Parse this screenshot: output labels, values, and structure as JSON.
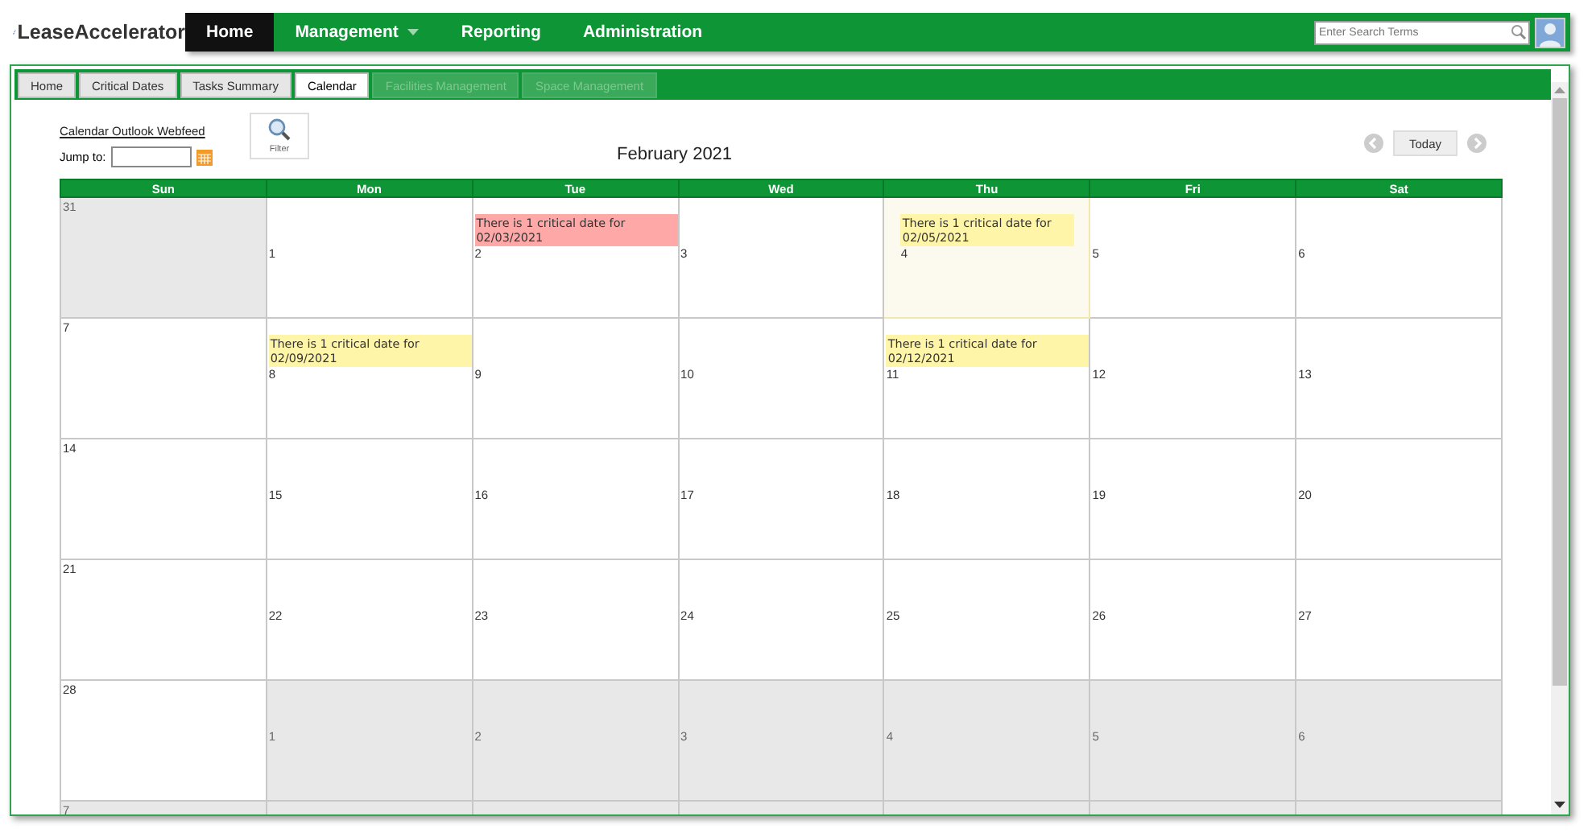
{
  "logo": {
    "text": "LeaseAccelerator"
  },
  "nav": [
    {
      "label": "Home",
      "selected": true,
      "dropdown": false
    },
    {
      "label": "Management",
      "selected": false,
      "dropdown": true
    },
    {
      "label": "Reporting",
      "selected": false,
      "dropdown": false
    },
    {
      "label": "Administration",
      "selected": false,
      "dropdown": false
    }
  ],
  "search": {
    "placeholder": "Enter Search Terms"
  },
  "tabs": [
    {
      "label": "Home",
      "selected": false,
      "disabled": false
    },
    {
      "label": "Critical Dates",
      "selected": false,
      "disabled": false
    },
    {
      "label": "Tasks Summary",
      "selected": false,
      "disabled": false
    },
    {
      "label": "Calendar",
      "selected": true,
      "disabled": false
    },
    {
      "label": "Facilities Management",
      "selected": false,
      "disabled": true
    },
    {
      "label": "Space Management",
      "selected": false,
      "disabled": true
    }
  ],
  "webfeed_link": "Calendar Outlook Webfeed",
  "jump_to": {
    "label": "Jump to:"
  },
  "filter_button": "Filter",
  "month_title": "February 2021",
  "today_button": "Today",
  "weekdays": [
    "Sun",
    "Mon",
    "Tue",
    "Wed",
    "Thu",
    "Fri",
    "Sat"
  ],
  "weeks": [
    [
      {
        "day": "31",
        "outside_month": true,
        "today": false
      },
      {
        "day": "1",
        "outside_month": false,
        "today": false
      },
      {
        "day": "2",
        "outside_month": false,
        "today": false,
        "events": [
          {
            "text": "There is 1 critical date for 02/03/2021",
            "color": "#ffa8a8"
          }
        ]
      },
      {
        "day": "3",
        "outside_month": false,
        "today": false
      },
      {
        "day": "4",
        "outside_month": false,
        "today": true,
        "events": [
          {
            "text": "There is 1 critical date for 02/05/2021",
            "color": "#fff5a8"
          }
        ]
      },
      {
        "day": "5",
        "outside_month": false,
        "today": false
      },
      {
        "day": "6",
        "outside_month": false,
        "today": false
      }
    ],
    [
      {
        "day": "7",
        "outside_month": false,
        "today": false
      },
      {
        "day": "8",
        "outside_month": false,
        "today": false,
        "events": [
          {
            "text": "There is 1 critical date for 02/09/2021",
            "color": "#fff5a8"
          }
        ]
      },
      {
        "day": "9",
        "outside_month": false,
        "today": false
      },
      {
        "day": "10",
        "outside_month": false,
        "today": false
      },
      {
        "day": "11",
        "outside_month": false,
        "today": false,
        "events": [
          {
            "text": "There is 1 critical date for 02/12/2021",
            "color": "#fff5a8"
          }
        ]
      },
      {
        "day": "12",
        "outside_month": false,
        "today": false
      },
      {
        "day": "13",
        "outside_month": false,
        "today": false
      }
    ],
    [
      {
        "day": "14",
        "outside_month": false,
        "today": false
      },
      {
        "day": "15",
        "outside_month": false,
        "today": false
      },
      {
        "day": "16",
        "outside_month": false,
        "today": false
      },
      {
        "day": "17",
        "outside_month": false,
        "today": false
      },
      {
        "day": "18",
        "outside_month": false,
        "today": false
      },
      {
        "day": "19",
        "outside_month": false,
        "today": false
      },
      {
        "day": "20",
        "outside_month": false,
        "today": false
      }
    ],
    [
      {
        "day": "21",
        "outside_month": false,
        "today": false
      },
      {
        "day": "22",
        "outside_month": false,
        "today": false
      },
      {
        "day": "23",
        "outside_month": false,
        "today": false
      },
      {
        "day": "24",
        "outside_month": false,
        "today": false
      },
      {
        "day": "25",
        "outside_month": false,
        "today": false
      },
      {
        "day": "26",
        "outside_month": false,
        "today": false
      },
      {
        "day": "27",
        "outside_month": false,
        "today": false
      }
    ],
    [
      {
        "day": "28",
        "outside_month": false,
        "today": false
      },
      {
        "day": "1",
        "outside_month": true,
        "today": false
      },
      {
        "day": "2",
        "outside_month": true,
        "today": false
      },
      {
        "day": "3",
        "outside_month": true,
        "today": false
      },
      {
        "day": "4",
        "outside_month": true,
        "today": false
      },
      {
        "day": "5",
        "outside_month": true,
        "today": false
      },
      {
        "day": "6",
        "outside_month": true,
        "today": false
      }
    ],
    [
      {
        "day": "7",
        "outside_month": true,
        "today": false
      },
      {
        "outside_month": true,
        "today": false
      },
      {
        "outside_month": true,
        "today": false
      },
      {
        "outside_month": true,
        "today": false
      },
      {
        "outside_month": true,
        "today": false
      },
      {
        "outside_month": true,
        "today": false
      },
      {
        "outside_month": true,
        "today": false
      }
    ]
  ]
}
